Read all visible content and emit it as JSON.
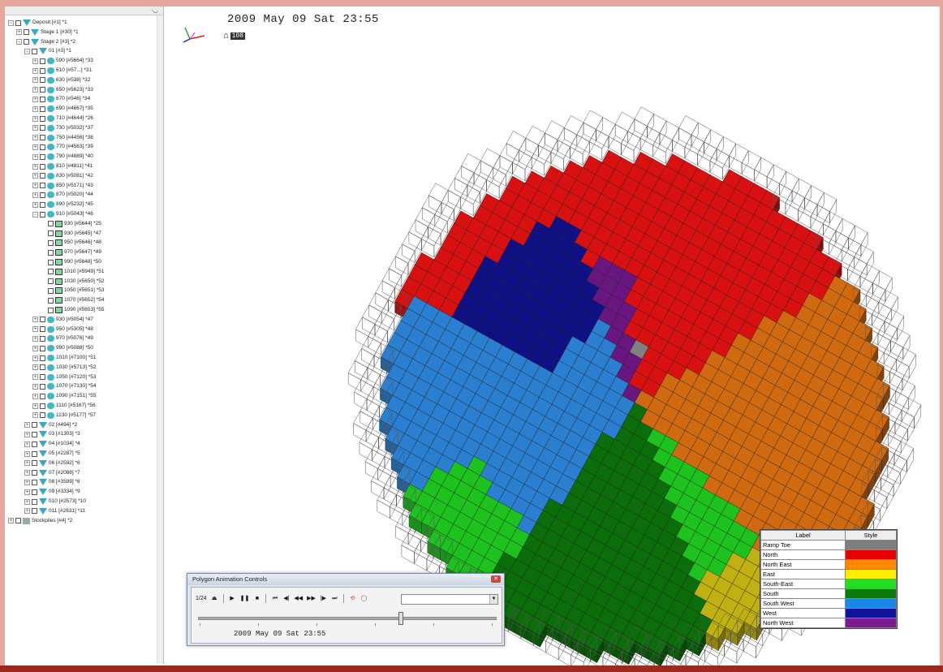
{
  "viewport": {
    "datetime": "2009 May 09 Sat  23:55",
    "frame_number": "108"
  },
  "tree": {
    "rows": [
      {
        "indent": 0,
        "exp": "−",
        "icon": "tri",
        "label": "Deposit [#1] *1"
      },
      {
        "indent": 1,
        "exp": "+",
        "icon": "tri",
        "label": "Stage 1 [#30] *1"
      },
      {
        "indent": 1,
        "exp": "−",
        "icon": "tri",
        "label": "Stage 2 [#3] *2"
      },
      {
        "indent": 2,
        "exp": "−",
        "icon": "tri",
        "label": "01 [#3] *1"
      },
      {
        "indent": 3,
        "exp": "+",
        "icon": "cyl",
        "label": "590 [#5664] *33"
      },
      {
        "indent": 3,
        "exp": "+",
        "icon": "cyl",
        "label": "610 [#57...] *31"
      },
      {
        "indent": 3,
        "exp": "+",
        "icon": "cyl",
        "label": "630 [#538] *32"
      },
      {
        "indent": 3,
        "exp": "+",
        "icon": "cyl",
        "label": "650 [#5623] *33"
      },
      {
        "indent": 3,
        "exp": "+",
        "icon": "cyl",
        "label": "670 [#546] *34"
      },
      {
        "indent": 3,
        "exp": "+",
        "icon": "cyl",
        "label": "690 [#4667] *35"
      },
      {
        "indent": 3,
        "exp": "+",
        "icon": "cyl",
        "label": "710 [#4644] *26"
      },
      {
        "indent": 3,
        "exp": "+",
        "icon": "cyl",
        "label": "730 [#5032] *37"
      },
      {
        "indent": 3,
        "exp": "+",
        "icon": "cyl",
        "label": "750 [#4456] *38"
      },
      {
        "indent": 3,
        "exp": "+",
        "icon": "cyl",
        "label": "770 [#4563] *39"
      },
      {
        "indent": 3,
        "exp": "+",
        "icon": "cyl",
        "label": "790 [#4889] *40"
      },
      {
        "indent": 3,
        "exp": "+",
        "icon": "cyl",
        "label": "810 [#4811] *41"
      },
      {
        "indent": 3,
        "exp": "+",
        "icon": "cyl",
        "label": "830 [#5081] *42"
      },
      {
        "indent": 3,
        "exp": "+",
        "icon": "cyl",
        "label": "850 [#5171] *43"
      },
      {
        "indent": 3,
        "exp": "+",
        "icon": "cyl",
        "label": "870 [#5020] *44"
      },
      {
        "indent": 3,
        "exp": "+",
        "icon": "cyl",
        "label": "890 [#5232] *45"
      },
      {
        "indent": 3,
        "exp": "−",
        "icon": "cyl",
        "label": "910 [#5043] *46"
      },
      {
        "indent": 4,
        "exp": "",
        "icon": "box",
        "label": "930 [#5644] *25"
      },
      {
        "indent": 4,
        "exp": "",
        "icon": "box",
        "label": "930 [#5645] *47"
      },
      {
        "indent": 4,
        "exp": "",
        "icon": "box",
        "label": "950 [#5646] *48"
      },
      {
        "indent": 4,
        "exp": "",
        "icon": "box",
        "label": "970 [#5647] *49"
      },
      {
        "indent": 4,
        "exp": "",
        "icon": "box",
        "label": "990 [#5648] *50"
      },
      {
        "indent": 4,
        "exp": "",
        "icon": "box",
        "label": "1010 [#5949] *51"
      },
      {
        "indent": 4,
        "exp": "",
        "icon": "box",
        "label": "1030 [#5650] *52"
      },
      {
        "indent": 4,
        "exp": "",
        "icon": "box",
        "label": "1050 [#5651] *53"
      },
      {
        "indent": 4,
        "exp": "",
        "icon": "box",
        "label": "1070 [#5652] *54"
      },
      {
        "indent": 4,
        "exp": "",
        "icon": "box",
        "label": "1090 [#5653] *55"
      },
      {
        "indent": 3,
        "exp": "+",
        "icon": "cyl",
        "label": "930 [#5054] *47"
      },
      {
        "indent": 3,
        "exp": "+",
        "icon": "cyl",
        "label": "950 [#5305] *48"
      },
      {
        "indent": 3,
        "exp": "+",
        "icon": "cyl",
        "label": "970 [#5076] *49"
      },
      {
        "indent": 3,
        "exp": "+",
        "icon": "cyl",
        "label": "990 [#5088] *50"
      },
      {
        "indent": 3,
        "exp": "+",
        "icon": "cyl",
        "label": "1010 [#7100] *51"
      },
      {
        "indent": 3,
        "exp": "+",
        "icon": "cyl",
        "label": "1030 [#5713] *52"
      },
      {
        "indent": 3,
        "exp": "+",
        "icon": "cyl",
        "label": "1050 [#7120] *53"
      },
      {
        "indent": 3,
        "exp": "+",
        "icon": "cyl",
        "label": "1070 [#7130] *54"
      },
      {
        "indent": 3,
        "exp": "+",
        "icon": "cyl",
        "label": "1090 [#7151] *55"
      },
      {
        "indent": 3,
        "exp": "+",
        "icon": "cyl",
        "label": "1110 [#5167] *56"
      },
      {
        "indent": 3,
        "exp": "+",
        "icon": "cyl",
        "label": "1130 [#5177] *57"
      },
      {
        "indent": 2,
        "exp": "+",
        "icon": "tri",
        "label": "02 [#494] *2"
      },
      {
        "indent": 2,
        "exp": "+",
        "icon": "tri",
        "label": "03 [#1303] *3"
      },
      {
        "indent": 2,
        "exp": "+",
        "icon": "tri",
        "label": "04 [#1034] *4"
      },
      {
        "indent": 2,
        "exp": "+",
        "icon": "tri",
        "label": "05 [#2287] *5"
      },
      {
        "indent": 2,
        "exp": "+",
        "icon": "tri",
        "label": "06 [#2592] *6"
      },
      {
        "indent": 2,
        "exp": "+",
        "icon": "tri",
        "label": "07 [#2088] *7"
      },
      {
        "indent": 2,
        "exp": "+",
        "icon": "tri",
        "label": "08 [#3599] *8"
      },
      {
        "indent": 2,
        "exp": "+",
        "icon": "tri",
        "label": "09 [#3334] *9"
      },
      {
        "indent": 2,
        "exp": "+",
        "icon": "tri",
        "label": "010 [#2573] *10"
      },
      {
        "indent": 2,
        "exp": "+",
        "icon": "tri",
        "label": "011 [#2631] *11"
      },
      {
        "indent": 0,
        "exp": "+",
        "icon": "blk",
        "label": "Stockpiles [#4] *2"
      }
    ]
  },
  "legend": {
    "header_label": "Label",
    "header_style": "Style",
    "rows": [
      {
        "label": "Ramp Toe",
        "color": "#7f7f7f"
      },
      {
        "label": "North",
        "color": "#e60000"
      },
      {
        "label": "North East",
        "color": "#ff8a00"
      },
      {
        "label": "East",
        "color": "#ffee00"
      },
      {
        "label": "South-East",
        "color": "#22dd22"
      },
      {
        "label": "South",
        "color": "#0a7a0a"
      },
      {
        "label": "South West",
        "color": "#1a88e8"
      },
      {
        "label": "West",
        "color": "#10149a"
      },
      {
        "label": "North West",
        "color": "#7a1a8c"
      }
    ]
  },
  "animation": {
    "title": "Polygon Animation Controls",
    "speed_label": "1/24",
    "date_text": "2009 May 09 Sat   23:55",
    "slider_position": 0.68
  },
  "colors": {
    "north": "#d81010",
    "north_east": "#d06a10",
    "east": "#c0b010",
    "south_east": "#1ec21e",
    "south": "#0b6e0b",
    "south_west": "#2a7fd0",
    "west": "#101085",
    "north_west": "#6a1680",
    "ramp_toe": "#808080"
  }
}
